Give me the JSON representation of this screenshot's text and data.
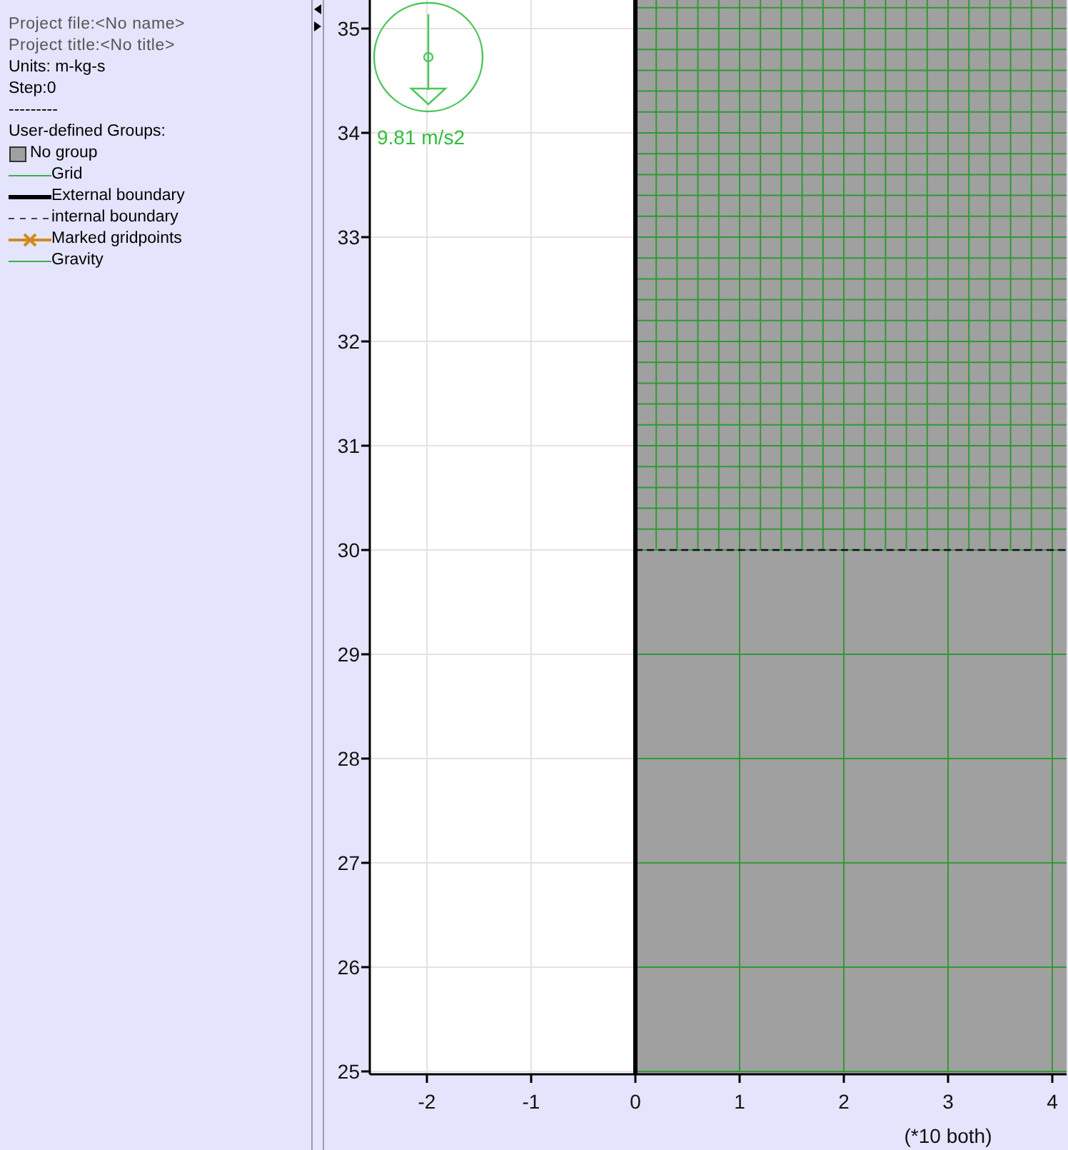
{
  "info": [
    {
      "text": "Project file:<No name>",
      "dim": true
    },
    {
      "text": "Project title:<No title>",
      "dim": true
    },
    {
      "text": "Units: m-kg-s",
      "dim": false
    },
    {
      "text": "Step:0",
      "dim": false
    },
    {
      "text": "---------",
      "dim": false
    },
    {
      "text": "User-defined Groups:",
      "dim": false
    }
  ],
  "legend": [
    {
      "kind": "swatch",
      "label": "No group"
    },
    {
      "kind": "line",
      "label": "Grid"
    },
    {
      "kind": "thick",
      "label": "External boundary"
    },
    {
      "kind": "dashed",
      "label": "internal boundary"
    },
    {
      "kind": "marked",
      "label": "Marked gridpoints"
    },
    {
      "kind": "line",
      "label": "Gravity"
    }
  ],
  "plot": {
    "y_ticks": [
      "35",
      "34",
      "33",
      "32",
      "31",
      "30",
      "29",
      "28",
      "27",
      "26",
      "25"
    ],
    "x_ticks": [
      "-2",
      "-1",
      "0",
      "1",
      "2",
      "3",
      "4"
    ],
    "axis_note": "(*10 both)",
    "gravity_label": "9.81 m/s2"
  }
}
